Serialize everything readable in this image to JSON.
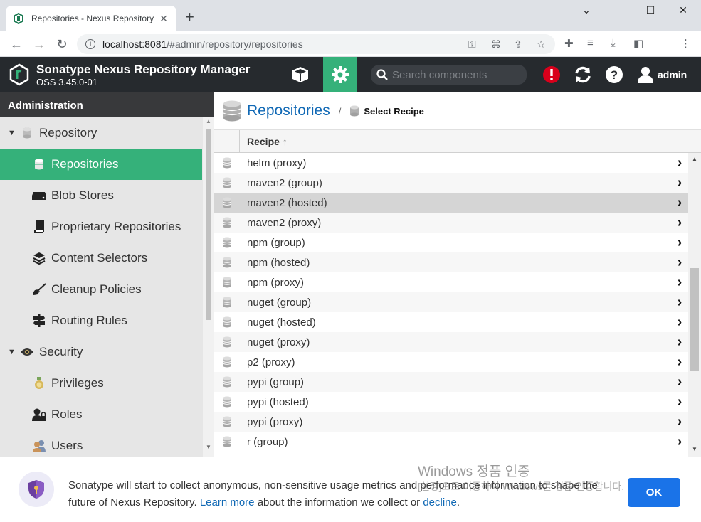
{
  "browser": {
    "tab_title": "Repositories - Nexus Repository",
    "url_host": "localhost:8081",
    "url_path": "/#admin/repository/repositories",
    "new_tab_symbol": "+",
    "window_controls": [
      "minimize",
      "maximize",
      "close"
    ]
  },
  "header": {
    "app_title": "Sonatype Nexus Repository Manager",
    "version": "OSS 3.45.0-01",
    "search_placeholder": "Search components",
    "user": "admin",
    "icons": [
      "browse-cube-icon",
      "admin-gear-icon",
      "alert-icon",
      "refresh-icon",
      "help-icon",
      "user-icon"
    ],
    "colors": {
      "bar": "#262a2e",
      "accent": "#35b17a",
      "alert": "#d9001b"
    }
  },
  "sidebar": {
    "title": "Administration",
    "items": [
      {
        "label": "Repository",
        "icon": "database-icon",
        "group": true
      },
      {
        "label": "Repositories",
        "icon": "database-icon",
        "active": true
      },
      {
        "label": "Blob Stores",
        "icon": "hard-drive-icon"
      },
      {
        "label": "Proprietary Repositories",
        "icon": "book-icon"
      },
      {
        "label": "Content Selectors",
        "icon": "layers-icon"
      },
      {
        "label": "Cleanup Policies",
        "icon": "broom-icon"
      },
      {
        "label": "Routing Rules",
        "icon": "signpost-icon"
      },
      {
        "label": "Security",
        "icon": "eye-icon",
        "group": true
      },
      {
        "label": "Privileges",
        "icon": "medal-icon"
      },
      {
        "label": "Roles",
        "icon": "user-lock-icon"
      },
      {
        "label": "Users",
        "icon": "users-icon"
      }
    ]
  },
  "main": {
    "title": "Repositories",
    "breadcrumb_sub": "Select Recipe",
    "column_header": "Recipe",
    "sort_indicator": "↑",
    "rows": [
      "helm (proxy)",
      "maven2 (group)",
      "maven2 (hosted)",
      "maven2 (proxy)",
      "npm (group)",
      "npm (hosted)",
      "npm (proxy)",
      "nuget (group)",
      "nuget (hosted)",
      "nuget (proxy)",
      "p2 (proxy)",
      "pypi (group)",
      "pypi (hosted)",
      "pypi (proxy)",
      "r (group)"
    ],
    "selected_row": "maven2 (hosted)"
  },
  "banner": {
    "text_before": "Sonatype will start to collect anonymous, non-sensitive usage metrics and performance information to shape the future of Nexus Repository. ",
    "learn_more": "Learn more",
    "text_middle": " about the information we collect or ",
    "decline": "decline",
    "text_end": ".",
    "ok_label": "OK"
  },
  "watermark": {
    "line1": "Windows 정품 인증",
    "line2": "[설정]으로 이동하여 Windows를 정품 인증합니다."
  }
}
